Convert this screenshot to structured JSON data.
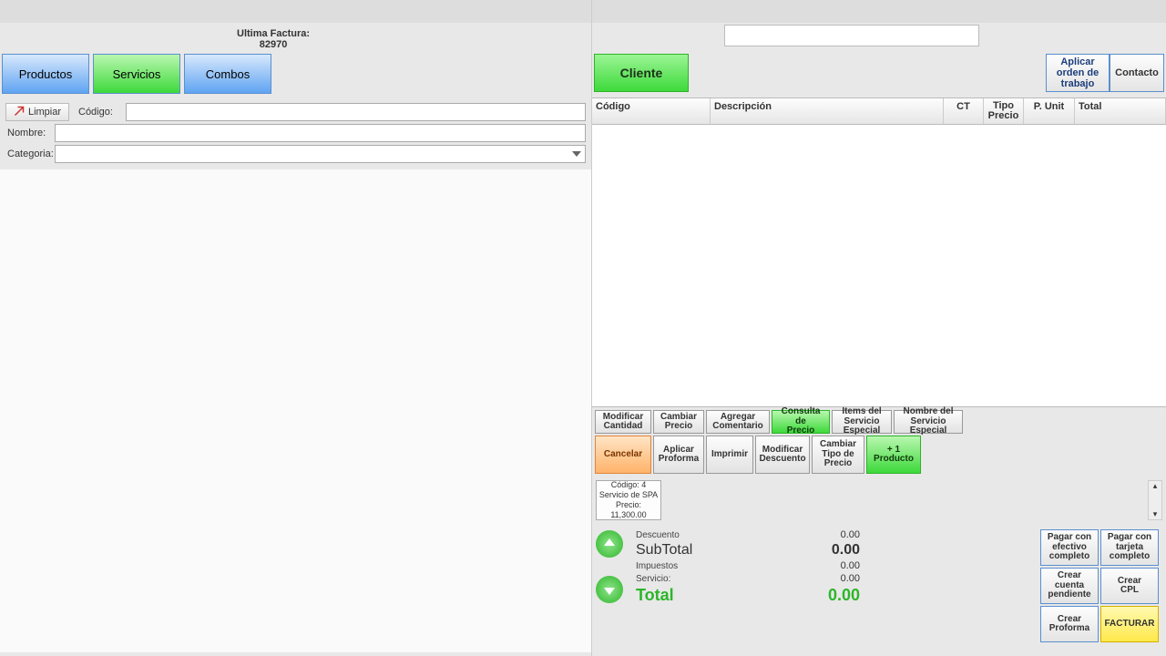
{
  "header": {
    "last_invoice_label": "Ultima Factura:",
    "last_invoice_number": "82970"
  },
  "tabs": {
    "productos": "Productos",
    "servicios": "Servicios",
    "combos": "Combos"
  },
  "filter": {
    "clear": "Limpiar",
    "codigo": "Código:",
    "nombre": "Nombre:",
    "categoria": "Categoria:"
  },
  "right_top": {
    "cliente": "Cliente",
    "aplicar_orden": "Aplicar orden\nde trabajo",
    "contacto": "Contacto"
  },
  "grid_head": {
    "codigo": "Código",
    "descripcion": "Descripción",
    "ct": "CT",
    "tipo_precio": "Tipo\nPrecio",
    "p_unit": "P. Unit",
    "total": "Total"
  },
  "actions_row1": {
    "modificar_cantidad": "Modificar\nCantidad",
    "cambiar_precio": "Cambiar\nPrecio",
    "agregar_comentario": "Agregar\nComentario",
    "consulta_precio": "Consulta de\nPrecio",
    "items_servicio": "Items del\nServicio Especial",
    "nombre_servicio": "Nombre del\nServicio Especial"
  },
  "actions_row2": {
    "cancelar": "Cancelar",
    "aplicar_proforma": "Aplicar\nProforma",
    "imprimir": "Imprimir",
    "modificar_descuento": "Modificar\nDescuento",
    "cambiar_tipo_precio": "Cambiar\nTipo de\nPrecio",
    "mas_uno": "+ 1\nProducto"
  },
  "recent": {
    "line1": "Código: 4",
    "line2": "Servicio de SPA",
    "line3": "Precio: 11,300.00"
  },
  "totals": {
    "descuento_label": "Descuento",
    "descuento_value": "0.00",
    "subtotal_label": "SubTotal",
    "subtotal_value": "0.00",
    "impuestos_label": "Impuestos",
    "impuestos_value": "0.00",
    "servicio_label": "Servicio:",
    "servicio_value": "0.00",
    "total_label": "Total",
    "total_value": "0.00"
  },
  "checkout": {
    "pagar_efectivo": "Pagar con\nefectivo\ncompleto",
    "pagar_tarjeta": "Pagar con\ntarjeta\ncompleto",
    "crear_cuenta": "Crear\ncuenta\npendiente",
    "crear_cpl": "Crear\nCPL",
    "crear_proforma": "Crear\nProforma",
    "facturar": "FACTURAR"
  }
}
